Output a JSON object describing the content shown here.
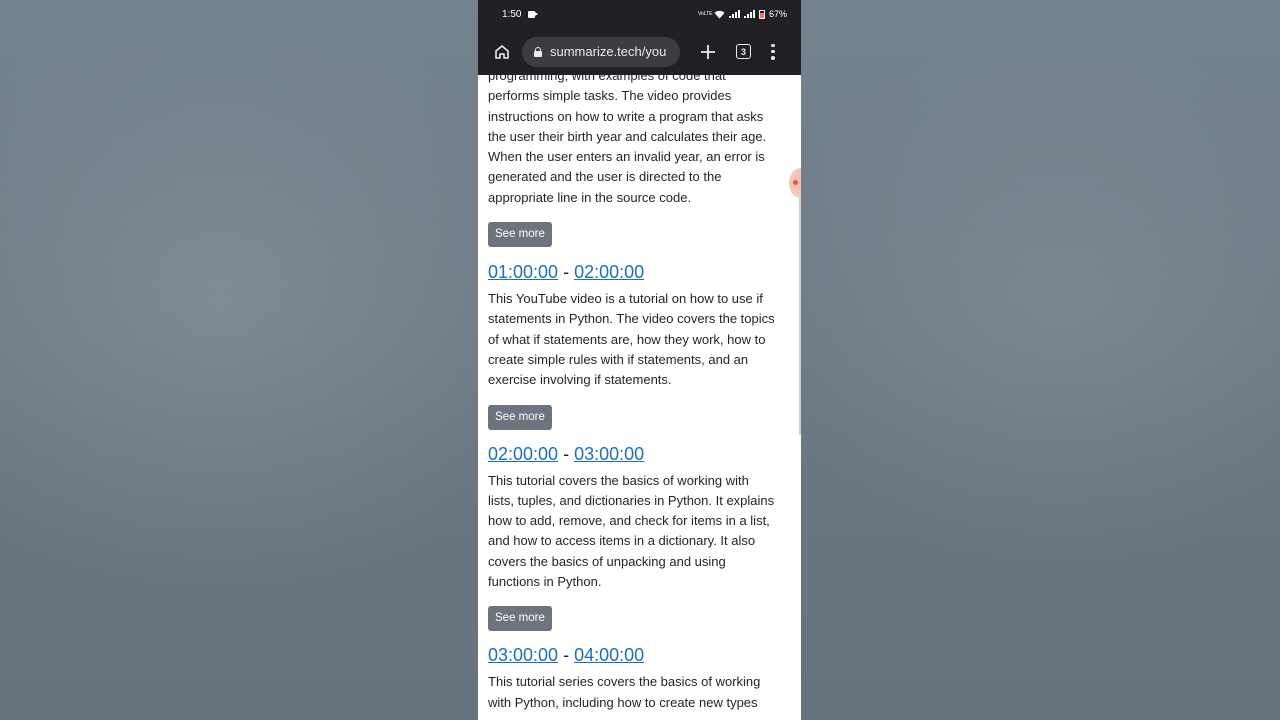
{
  "status_bar": {
    "time": "1:50",
    "network_label": "VoLTE",
    "battery_percent": "67%"
  },
  "browser": {
    "url": "summarize.tech/you",
    "tab_count": "3",
    "icons": {
      "home": "home-icon",
      "lock": "lock-icon",
      "new_tab": "plus-icon",
      "tabs": "tabs-icon",
      "menu": "more-vert-icon"
    }
  },
  "colors": {
    "link": "#1a6fc0",
    "button_bg": "#6c757d",
    "toolbar_bg": "#202124"
  },
  "sections": [
    {
      "summary": "programming, with examples of code that performs simple tasks. The video provides instructions on how to write a program that asks the user their birth year and calculates their age. When the user enters an invalid year, an error is generated and the user is directed to the appropriate line in the source code.",
      "lines": [
        "programming, with examples of code that",
        "performs simple tasks. The video provides",
        "instructions on how to write a program that asks",
        "the user their birth year and calculates their age.",
        "When the user enters an invalid year, an error is",
        "generated and the user is directed to the",
        "appropriate line in the source code."
      ],
      "button": "See more"
    },
    {
      "start": "01:00:00",
      "separator": "-",
      "end": "02:00:00",
      "lines": [
        "This YouTube video is a tutorial on how to use if",
        "statements in Python. The video covers the topics",
        "of what if statements are, how they work, how to",
        "create simple rules with if statements, and an",
        "exercise involving if statements."
      ],
      "button": "See more"
    },
    {
      "start": "02:00:00",
      "separator": "-",
      "end": "03:00:00",
      "lines": [
        "This tutorial covers the basics of working with",
        "lists, tuples, and dictionaries in Python. It explains",
        "how to add, remove, and check for items in a list,",
        "and how to access items in a dictionary. It also",
        "covers the basics of unpacking and using",
        "functions in Python."
      ],
      "button": "See more"
    },
    {
      "start": "03:00:00",
      "separator": "-",
      "end": "04:00:00",
      "lines": [
        "This tutorial series covers the basics of working",
        "with Python, including how to create new types"
      ]
    }
  ]
}
